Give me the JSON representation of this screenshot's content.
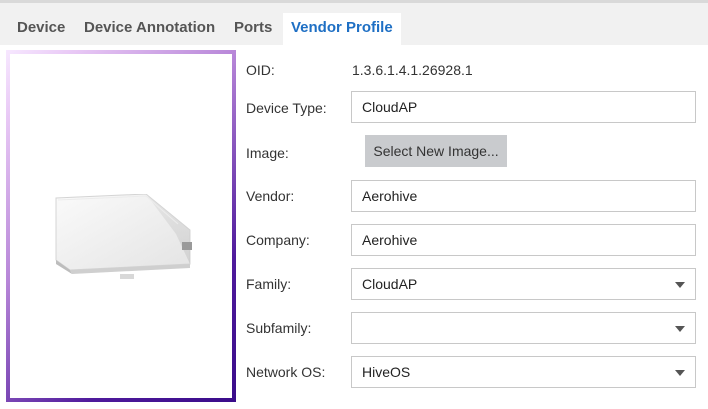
{
  "tabs": [
    {
      "label": "Device"
    },
    {
      "label": "Device Annotation"
    },
    {
      "label": "Ports"
    },
    {
      "label": "Vendor Profile",
      "active": true
    }
  ],
  "form": {
    "oid": {
      "label": "OID:",
      "value": "1.3.6.1.4.1.26928.1"
    },
    "device_type": {
      "label": "Device Type:",
      "value": "CloudAP"
    },
    "image": {
      "label": "Image:",
      "button": "Select New Image..."
    },
    "vendor": {
      "label": "Vendor:",
      "value": "Aerohive"
    },
    "company": {
      "label": "Company:",
      "value": "Aerohive"
    },
    "family": {
      "label": "Family:",
      "value": "CloudAP"
    },
    "subfamily": {
      "label": "Subfamily:",
      "value": ""
    },
    "network_os": {
      "label": "Network OS:",
      "value": "HiveOS"
    }
  },
  "colors": {
    "active_tab": "#1e6fc4",
    "frame_dark": "#3a0c8a",
    "frame_light": "#f7e8ff",
    "button_bg": "#c9cbce"
  },
  "icons": [
    "chevron-down-icon"
  ]
}
